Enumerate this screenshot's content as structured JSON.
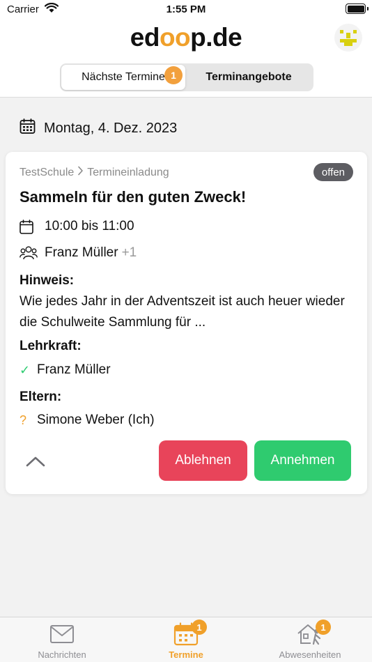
{
  "status_bar": {
    "carrier": "Carrier",
    "time": "1:55 PM"
  },
  "header": {
    "logo_prefix": "ed",
    "logo_owl": "oo",
    "logo_suffix": "p.de",
    "avatar_icon": "smiley-avatar-icon",
    "tabs": [
      {
        "label": "Nächste Termine",
        "badge": "1",
        "active": true
      },
      {
        "label": "Terminangebote",
        "active": false
      }
    ]
  },
  "date": {
    "icon": "calendar-icon",
    "text": "Montag, 4. Dez. 2023"
  },
  "card": {
    "breadcrumb_school": "TestSchule",
    "breadcrumb_type": "Termineinladung",
    "status": "offen",
    "title": "Sammeln für den guten Zweck!",
    "time": "10:00 bis 11:00",
    "participants": "Franz Müller",
    "participants_more": "+1",
    "hint_label": "Hinweis:",
    "hint_text": "Wie jedes Jahr in der Adventszeit ist auch heuer wieder die Schulweite Sammlung für ...",
    "teacher_label": "Lehrkraft:",
    "teacher_name": "Franz Müller",
    "teacher_mark": "✓",
    "parents_label": "Eltern:",
    "parent_name": "Simone Weber (Ich)",
    "parent_mark": "?",
    "decline_label": "Ablehnen",
    "accept_label": "Annehmen"
  },
  "tabbar": {
    "items": [
      {
        "label": "Nachrichten",
        "icon": "envelope-icon"
      },
      {
        "label": "Termine",
        "icon": "calendar-icon",
        "badge": "1",
        "active": true
      },
      {
        "label": "Abwesenheiten",
        "icon": "house-person-icon",
        "badge": "1"
      }
    ]
  },
  "colors": {
    "accent": "#f0a02a",
    "decline": "#e8445a",
    "accept": "#2fcb6f",
    "status_badge": "#5d5d62"
  }
}
